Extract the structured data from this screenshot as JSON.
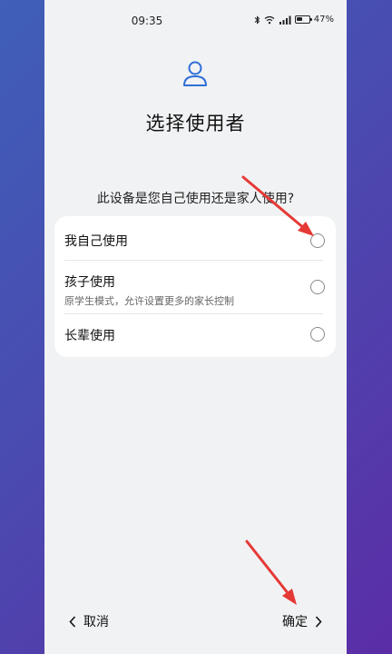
{
  "status_bar": {
    "time": "09:35",
    "battery_percent": "47%",
    "icons": [
      "bluetooth-icon",
      "wifi-icon",
      "signal-icon",
      "battery-icon"
    ]
  },
  "header": {
    "icon": "user-icon",
    "title": "选择使用者"
  },
  "question": "此设备是您自己使用还是家人使用?",
  "options": [
    {
      "label": "我自己使用",
      "description": "",
      "selected": false
    },
    {
      "label": "孩子使用",
      "description": "原学生模式，允许设置更多的家长控制",
      "selected": false
    },
    {
      "label": "长辈使用",
      "description": "",
      "selected": false
    }
  ],
  "footer": {
    "cancel_label": "取消",
    "confirm_label": "确定"
  },
  "colors": {
    "accent": "#2f6fd6",
    "annotation_arrow": "#e53935",
    "background_gradient": [
      "#3f5fb8",
      "#5b2da6"
    ],
    "screen_bg": "#f1f2f4"
  }
}
